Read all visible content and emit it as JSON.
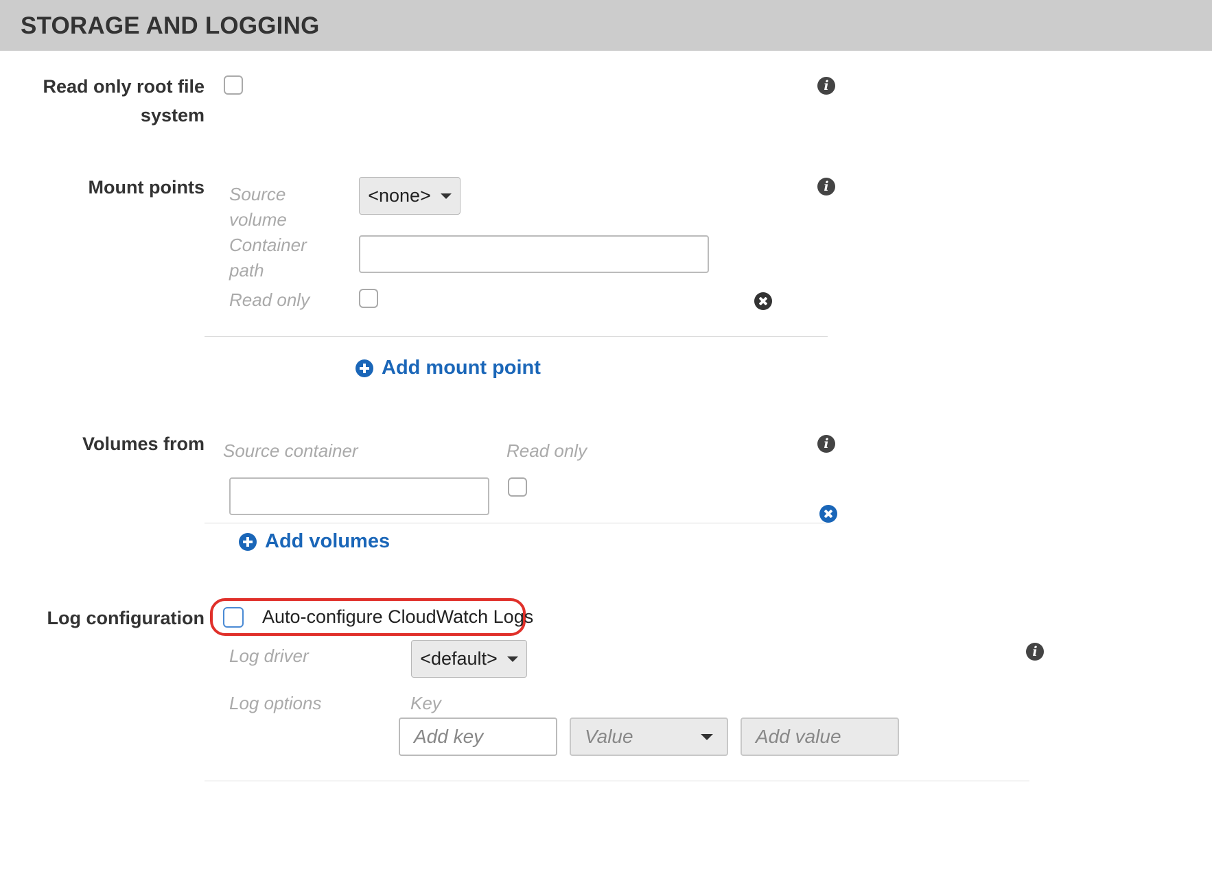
{
  "section": {
    "title": "STORAGE AND LOGGING"
  },
  "read_only_root": {
    "label_line1": "Read only root file",
    "label_line2": "system",
    "checked": false
  },
  "mount_points": {
    "label": "Mount points",
    "source_volume_label_1": "Source",
    "source_volume_label_2": "volume",
    "source_volume_value": "<none>",
    "container_path_label_1": "Container",
    "container_path_label_2": "path",
    "container_path_value": "",
    "read_only_label": "Read only",
    "add_label": "Add mount point"
  },
  "volumes_from": {
    "label": "Volumes from",
    "source_container_header": "Source container",
    "read_only_header": "Read only",
    "source_container_value": "",
    "add_label": "Add volumes"
  },
  "log_configuration": {
    "label": "Log configuration",
    "auto_configure_label": "Auto-configure CloudWatch Logs",
    "auto_configure_checked": false,
    "log_driver_label": "Log driver",
    "log_driver_value": "<default>",
    "log_options_label": "Log options",
    "key_header": "Key",
    "key_placeholder": "Add key",
    "value_type_placeholder": "Value",
    "value_placeholder": "Add value"
  },
  "colors": {
    "header_bg": "#cccccc",
    "link": "#1a66b8",
    "highlight_border": "#e0302a",
    "remove_icon_dark": "#333333",
    "remove_icon_blue": "#1a66b8"
  },
  "icons": [
    "info-icon",
    "remove-icon",
    "add-icon",
    "caret-down-icon"
  ]
}
